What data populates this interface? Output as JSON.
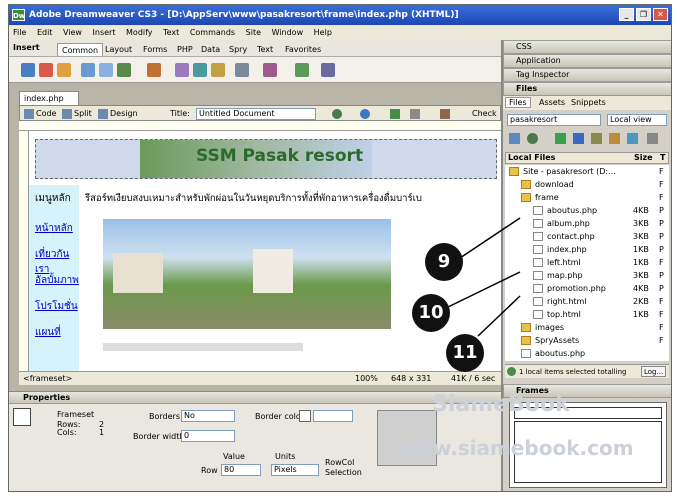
{
  "titlebar": {
    "title": "Adobe Dreamweaver CS3 - [D:\\AppServ\\www\\pasakresort\\frame\\index.php (XHTML)]",
    "minimize": "_",
    "restore": "❐",
    "close": "✕"
  },
  "menu": [
    "File",
    "Edit",
    "View",
    "Insert",
    "Modify",
    "Text",
    "Commands",
    "Site",
    "Window",
    "Help"
  ],
  "insertbar": {
    "label": "Insert",
    "tabs": [
      "Common",
      "Layout",
      "Forms",
      "PHP",
      "Data",
      "Spry",
      "Text",
      "Favorites"
    ]
  },
  "document": {
    "tab": "index.php",
    "view_buttons": [
      "Code",
      "Split",
      "Design"
    ],
    "title_label": "Title:",
    "title_value": "Untitled Document",
    "check": "Check"
  },
  "page": {
    "banner": "SSM Pasak resort",
    "nav": [
      "เมนูหลัก",
      "หน้าหลัก",
      "เที่ยวกันเรา",
      "อัลบั้มภาพ",
      "โปรโมชั่น",
      "แผนที่"
    ],
    "headline": "รีสอร์ทเงียบสงบเหมาะสำหรับพักผ่อนในวันหยุดบริการทั้งที่พักอาหารเครื่องดื่มบาร์เบ"
  },
  "status": {
    "tag": "<frameset>",
    "zoom": "100%",
    "size": "648 x 331",
    "weight": "41K / 6 sec"
  },
  "properties": {
    "header": "Properties",
    "name": "Frameset",
    "rows_label": "Rows:",
    "rows": "2",
    "cols_label": "Cols:",
    "cols": "1",
    "borders_label": "Borders",
    "borders": "No",
    "border_color_label": "Border color",
    "border_width_label": "Border width",
    "border_width": "0",
    "value_label": "Value",
    "units_label": "Units",
    "row_label": "Row",
    "row_value": "80",
    "units": "Pixels",
    "rowcol": "RowCol",
    "selection": "Selection"
  },
  "panels": {
    "css": "CSS",
    "application": "Application",
    "tag_inspector": "Tag Inspector",
    "files": "Files",
    "frames": "Frames"
  },
  "files": {
    "tabs": [
      "Files",
      "Assets",
      "Snippets"
    ],
    "site": "pasakresort",
    "view": "Local view",
    "col_local": "Local Files",
    "col_size": "Size",
    "col_type": "T",
    "tree": [
      {
        "name": "Site - pasakresort (D:...",
        "size": "",
        "type": "F",
        "depth": 0,
        "kind": "site"
      },
      {
        "name": "download",
        "size": "",
        "type": "F",
        "depth": 1,
        "kind": "folder"
      },
      {
        "name": "frame",
        "size": "",
        "type": "F",
        "depth": 1,
        "kind": "folder"
      },
      {
        "name": "aboutus.php",
        "size": "4KB",
        "type": "P",
        "depth": 2,
        "kind": "file"
      },
      {
        "name": "album.php",
        "size": "3KB",
        "type": "P",
        "depth": 2,
        "kind": "file"
      },
      {
        "name": "contact.php",
        "size": "3KB",
        "type": "P",
        "depth": 2,
        "kind": "file"
      },
      {
        "name": "index.php",
        "size": "1KB",
        "type": "P",
        "depth": 2,
        "kind": "file"
      },
      {
        "name": "left.html",
        "size": "1KB",
        "type": "F",
        "depth": 2,
        "kind": "file"
      },
      {
        "name": "map.php",
        "size": "3KB",
        "type": "P",
        "depth": 2,
        "kind": "file"
      },
      {
        "name": "promotion.php",
        "size": "4KB",
        "type": "P",
        "depth": 2,
        "kind": "file"
      },
      {
        "name": "right.html",
        "size": "2KB",
        "type": "F",
        "depth": 2,
        "kind": "file"
      },
      {
        "name": "top.html",
        "size": "1KB",
        "type": "F",
        "depth": 2,
        "kind": "file"
      },
      {
        "name": "images",
        "size": "",
        "type": "F",
        "depth": 1,
        "kind": "folder"
      },
      {
        "name": "SpryAssets",
        "size": "",
        "type": "F",
        "depth": 1,
        "kind": "folder"
      },
      {
        "name": "aboutus.php",
        "size": "",
        "type": "",
        "depth": 1,
        "kind": "file"
      }
    ],
    "status": "1 local items selected totalling",
    "log": "Log..."
  },
  "callouts": [
    "9",
    "10",
    "11"
  ],
  "watermark": {
    "brand": "SiameBook",
    "url": "www.siamebook.com"
  }
}
